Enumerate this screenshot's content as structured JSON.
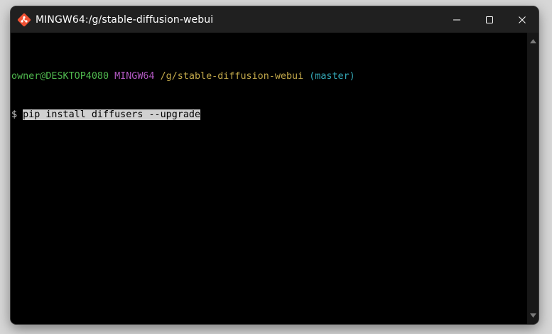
{
  "window": {
    "title": "MINGW64:/g/stable-diffusion-webui",
    "app_icon": "git-bash-icon",
    "controls": {
      "minimize": "minimize-icon",
      "maximize": "maximize-icon",
      "close": "close-icon"
    }
  },
  "terminal": {
    "prompt": {
      "user_host": "owner@DESKTOP4080",
      "system": "MINGW64",
      "path": "/g/stable-diffusion-webui",
      "branch": "(master)"
    },
    "input": {
      "symbol": "$",
      "command": "pip install diffusers --upgrade"
    }
  },
  "colors": {
    "user_host": "#4fb84e",
    "system": "#b259c2",
    "path": "#c2a84a",
    "branch": "#34a9b7",
    "titlebar": "#202020",
    "background": "#000000"
  }
}
